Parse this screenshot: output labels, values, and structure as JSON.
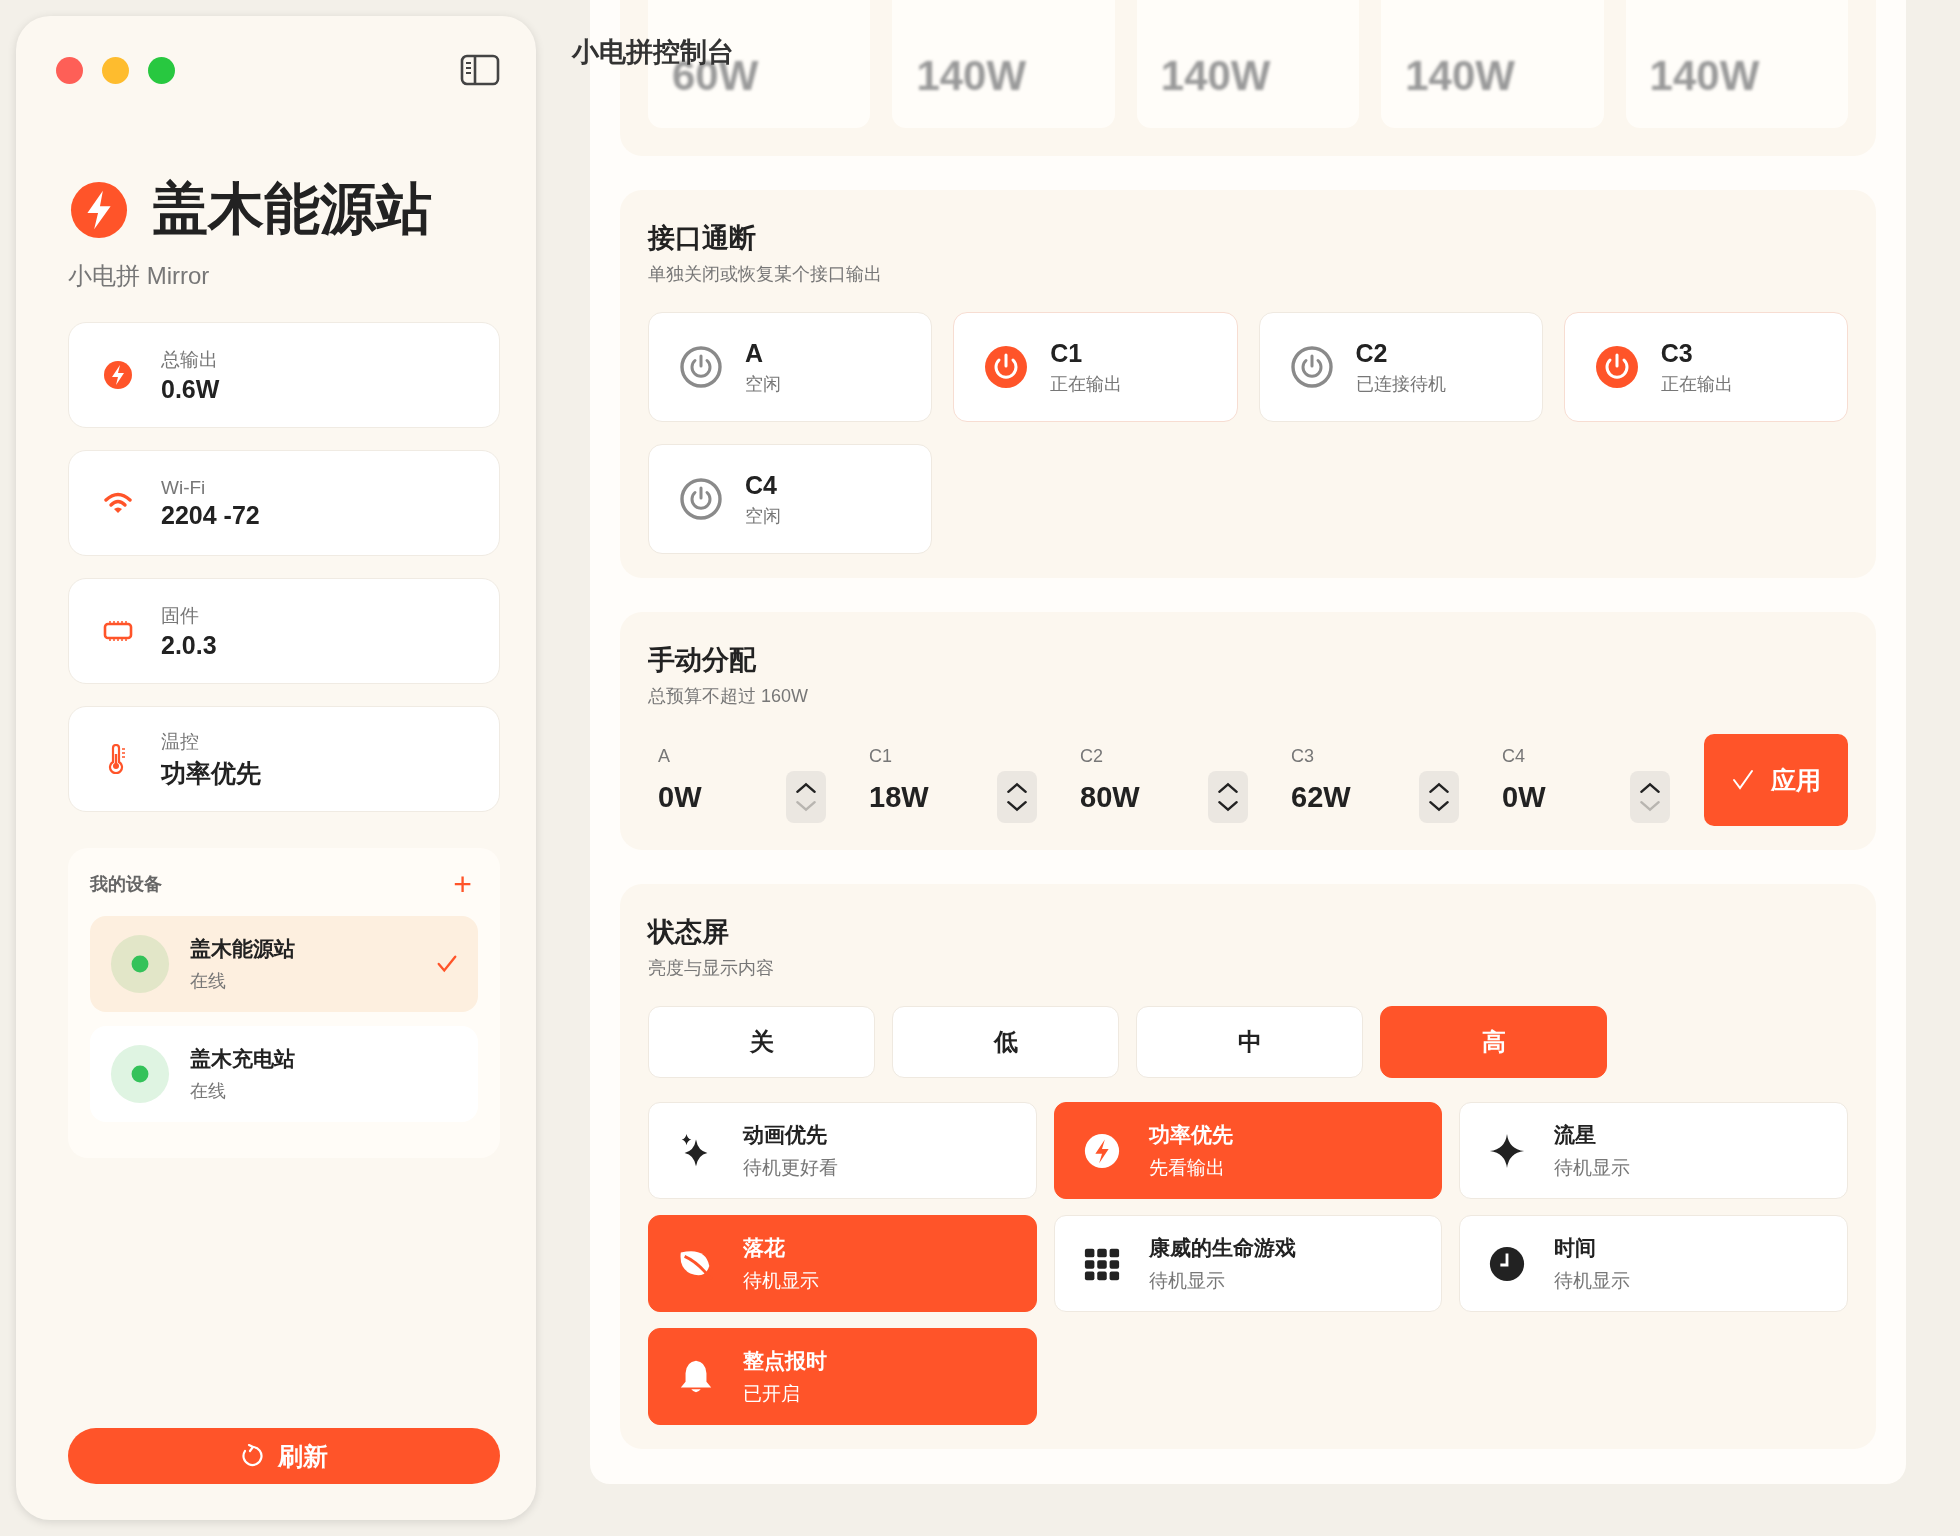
{
  "window": {
    "title": "小电拼控制台"
  },
  "sidebar": {
    "brand": {
      "name": "盖木能源站",
      "subtitle": "小电拼 Mirror"
    },
    "stats": [
      {
        "kind": "power",
        "label": "总输出",
        "value": "0.6W"
      },
      {
        "kind": "wifi",
        "label": "Wi-Fi",
        "value": "2204 -72"
      },
      {
        "kind": "chip",
        "label": "固件",
        "value": "2.0.3"
      },
      {
        "kind": "thermo",
        "label": "温控",
        "value": "功率优先"
      }
    ],
    "devices": {
      "title": "我的设备",
      "add": "+",
      "items": [
        {
          "name": "盖木能源站",
          "status": "在线",
          "selected": true
        },
        {
          "name": "盖木充电站",
          "status": "在线",
          "selected": false
        }
      ]
    },
    "refresh_button": "刷新"
  },
  "top_section": {
    "cards": [
      {
        "value": "60W"
      },
      {
        "value": "140W"
      },
      {
        "value": "140W"
      },
      {
        "value": "140W"
      },
      {
        "value": "140W"
      }
    ]
  },
  "ports": {
    "title": "接口通断",
    "subtitle": "单独关闭或恢复某个接口输出",
    "items": [
      {
        "name": "A",
        "status": "空闲",
        "on": false
      },
      {
        "name": "C1",
        "status": "正在输出",
        "on": true
      },
      {
        "name": "C2",
        "status": "已连接待机",
        "on": false
      },
      {
        "name": "C3",
        "status": "正在输出",
        "on": true
      },
      {
        "name": "C4",
        "status": "空闲",
        "on": false
      }
    ]
  },
  "manual": {
    "title": "手动分配",
    "subtitle": "总预算不超过 160W",
    "items": [
      {
        "label": "A",
        "value": "0W",
        "can_decrease": false
      },
      {
        "label": "C1",
        "value": "18W",
        "can_decrease": true
      },
      {
        "label": "C2",
        "value": "80W",
        "can_decrease": true
      },
      {
        "label": "C3",
        "value": "62W",
        "can_decrease": true
      },
      {
        "label": "C4",
        "value": "0W",
        "can_decrease": false
      }
    ],
    "apply": "应用"
  },
  "screen": {
    "title": "状态屏",
    "subtitle": "亮度与显示内容",
    "brightness": [
      {
        "label": "关",
        "selected": false
      },
      {
        "label": "低",
        "selected": false
      },
      {
        "label": "中",
        "selected": false
      },
      {
        "label": "高",
        "selected": true
      }
    ],
    "modes": [
      {
        "kind": "sparkles",
        "title": "动画优先",
        "subtitle": "待机更好看",
        "on": false
      },
      {
        "kind": "bolt",
        "title": "功率优先",
        "subtitle": "先看输出",
        "on": true
      },
      {
        "kind": "star",
        "title": "流星",
        "subtitle": "待机显示",
        "on": false
      },
      {
        "kind": "leaf",
        "title": "落花",
        "subtitle": "待机显示",
        "on": true
      },
      {
        "kind": "grid",
        "title": "康威的生命游戏",
        "subtitle": "待机显示",
        "on": false
      },
      {
        "kind": "clock",
        "title": "时间",
        "subtitle": "待机显示",
        "on": false
      },
      {
        "kind": "bell",
        "title": "整点报时",
        "subtitle": "已开启",
        "on": true
      }
    ]
  }
}
